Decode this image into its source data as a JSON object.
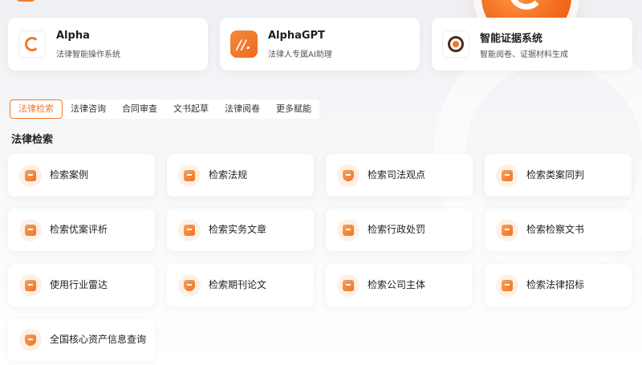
{
  "products": [
    {
      "title": "Alpha",
      "desc": "法律智能操作系统",
      "icon": "alpha-logo-icon"
    },
    {
      "title": "AlphaGPT",
      "desc": "法律人专属AI助理",
      "icon": "alphagpt-logo-icon"
    },
    {
      "title": "智能证据系统",
      "desc": "智能阅卷、证据材料生成",
      "icon": "evidence-system-icon"
    }
  ],
  "tabs": [
    "法律检索",
    "法律咨询",
    "合同审查",
    "文书起草",
    "法律阅卷",
    "更多赋能"
  ],
  "active_tab": "法律检索",
  "section_title": "法律检索",
  "features": [
    {
      "label": "检索案例",
      "icon": "case-icon"
    },
    {
      "label": "检索法规",
      "icon": "regulation-icon"
    },
    {
      "label": "检索司法观点",
      "icon": "judicial-view-icon"
    },
    {
      "label": "检索类案同判",
      "icon": "similar-case-icon"
    },
    {
      "label": "检索优案评析",
      "icon": "case-review-icon"
    },
    {
      "label": "检索实务文章",
      "icon": "practice-article-icon"
    },
    {
      "label": "检索行政处罚",
      "icon": "admin-penalty-icon"
    },
    {
      "label": "检索检察文书",
      "icon": "procuratorate-doc-icon"
    },
    {
      "label": "使用行业雷达",
      "icon": "industry-radar-icon"
    },
    {
      "label": "检索期刊论文",
      "icon": "journal-paper-icon"
    },
    {
      "label": "检索公司主体",
      "icon": "company-entity-icon"
    },
    {
      "label": "检索法律招标",
      "icon": "legal-bidding-icon"
    },
    {
      "label": "全国核心资产信息查询",
      "icon": "core-asset-icon"
    }
  ],
  "colors": {
    "accent": "#f07a2c",
    "icon_bg": "#fdf0e6"
  }
}
